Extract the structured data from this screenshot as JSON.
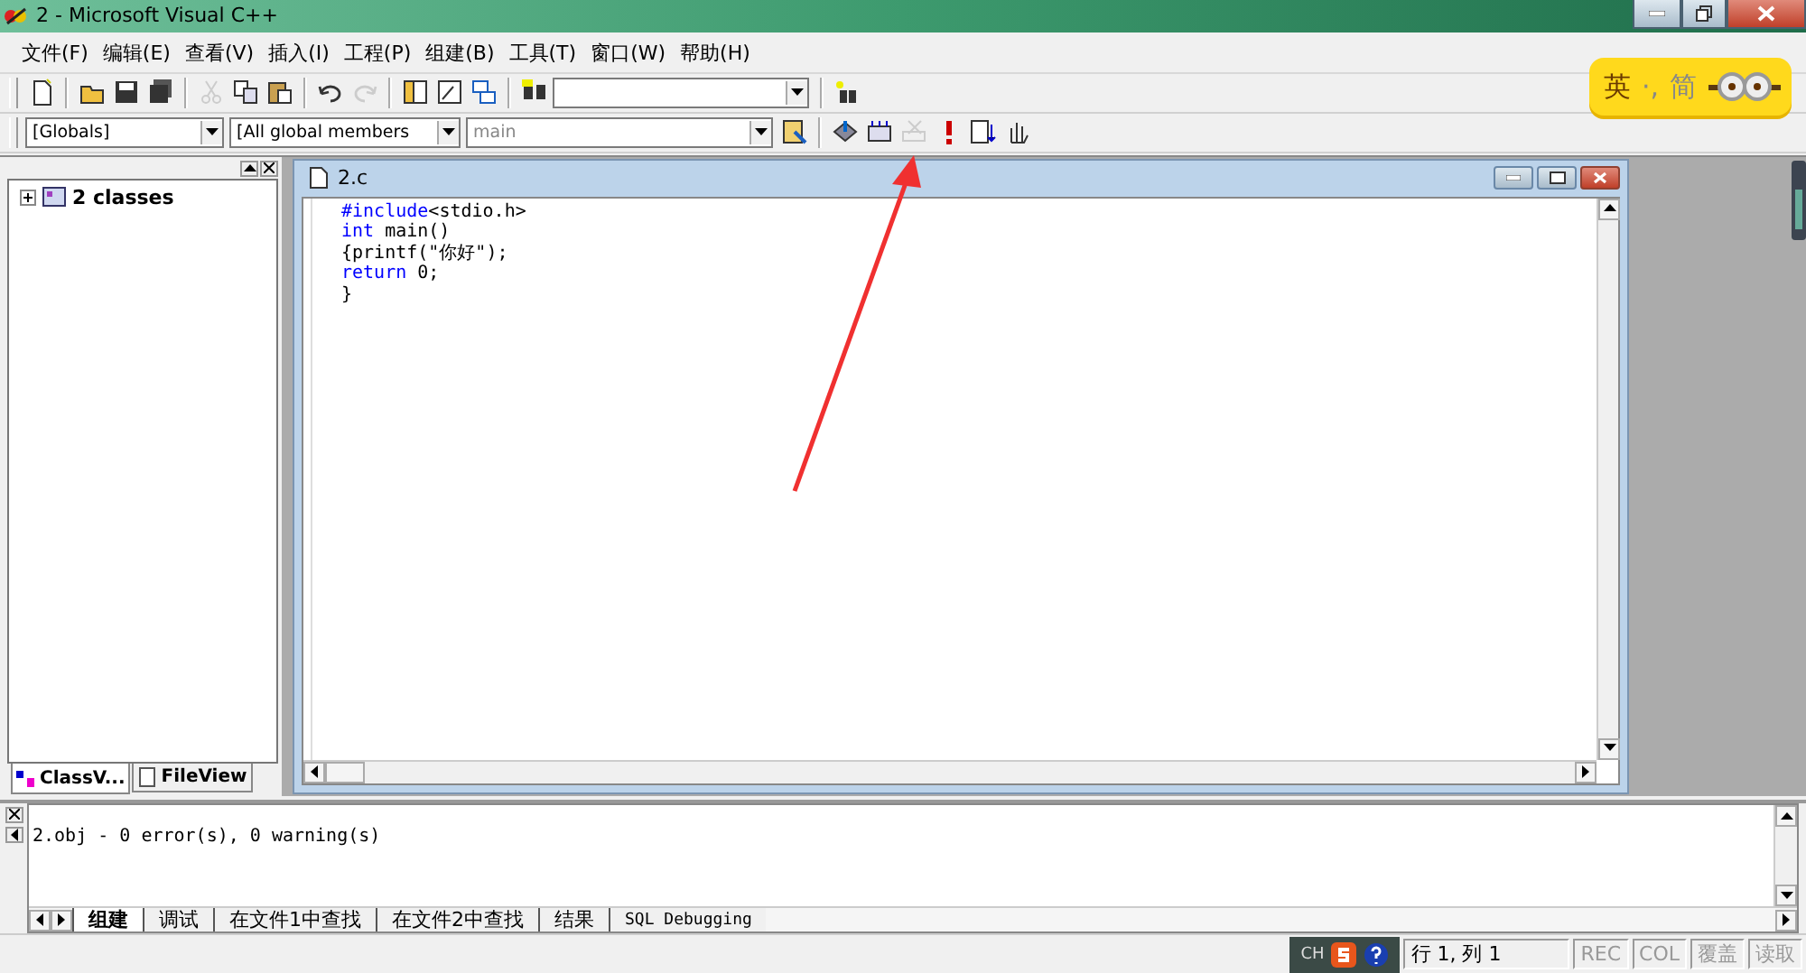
{
  "window": {
    "title": "2 - Microsoft Visual C++"
  },
  "menu": [
    "文件(F)",
    "编辑(E)",
    "查看(V)",
    "插入(I)",
    "工程(P)",
    "组建(B)",
    "工具(T)",
    "窗口(W)",
    "帮助(H)"
  ],
  "toolbar": [
    {
      "kind": "new",
      "disabled": false
    },
    {
      "kind": "sep"
    },
    {
      "kind": "open",
      "disabled": false
    },
    {
      "kind": "save",
      "disabled": false
    },
    {
      "kind": "saveall",
      "disabled": false
    },
    {
      "kind": "sep"
    },
    {
      "kind": "cut",
      "disabled": true
    },
    {
      "kind": "copy",
      "disabled": false
    },
    {
      "kind": "paste",
      "disabled": false
    },
    {
      "kind": "sep"
    },
    {
      "kind": "undo",
      "disabled": false
    },
    {
      "kind": "redo",
      "disabled": true
    },
    {
      "kind": "sep"
    },
    {
      "kind": "workspace",
      "disabled": false
    },
    {
      "kind": "output",
      "disabled": false
    },
    {
      "kind": "windows",
      "disabled": false
    },
    {
      "kind": "sep"
    },
    {
      "kind": "findfiles",
      "disabled": false
    },
    {
      "kind": "combo"
    },
    {
      "kind": "sep"
    },
    {
      "kind": "find",
      "disabled": false
    }
  ],
  "wizard_bar": {
    "combos": [
      {
        "value": "[Globals]",
        "disabled": false
      },
      {
        "value": "[All global members",
        "disabled": false
      },
      {
        "value": "main",
        "disabled": true
      }
    ],
    "buttons": [
      {
        "kind": "action",
        "disabled": false
      },
      {
        "kind": "sep"
      },
      {
        "kind": "compile",
        "disabled": false
      },
      {
        "kind": "build",
        "disabled": false
      },
      {
        "kind": "stop",
        "disabled": true
      },
      {
        "kind": "execute",
        "disabled": false
      },
      {
        "kind": "breakpointlist",
        "disabled": false
      },
      {
        "kind": "breakpoint",
        "disabled": false
      }
    ]
  },
  "ime_widget": {
    "mode": "英",
    "punct": "·,",
    "script": "简"
  },
  "workspace": {
    "tree": [
      {
        "label": "2 classes",
        "expanded": false
      }
    ],
    "tabs": [
      {
        "label": "ClassV...",
        "selected": true
      },
      {
        "label": "FileView",
        "selected": false
      }
    ]
  },
  "editor": {
    "title": "2.c",
    "lines": [
      [
        {
          "text": "#include",
          "kind": "keyword"
        },
        {
          "text": "<stdio.h>",
          "kind": "plain"
        }
      ],
      [
        {
          "text": "int",
          "kind": "keyword"
        },
        {
          "text": " main()",
          "kind": "plain"
        }
      ],
      [
        {
          "text": "{printf(\"你好\");",
          "kind": "plain"
        }
      ],
      [
        {
          "text": "return",
          "kind": "keyword"
        },
        {
          "text": " 0;",
          "kind": "plain"
        }
      ],
      [
        {
          "text": "}",
          "kind": "plain"
        }
      ]
    ]
  },
  "output": {
    "text": "2.obj - 0 error(s), 0 warning(s)",
    "tabs": [
      {
        "label": "组建",
        "selected": true
      },
      {
        "label": "调试",
        "selected": false
      },
      {
        "label": "在文件1中查找",
        "selected": false
      },
      {
        "label": "在文件2中查找",
        "selected": false
      },
      {
        "label": "结果",
        "selected": false
      },
      {
        "label": "SQL Debugging",
        "selected": false
      }
    ]
  },
  "status_bar": {
    "ime": "CH",
    "position": "行 1, 列 1",
    "indicators": [
      {
        "label": "REC",
        "disabled": true
      },
      {
        "label": "COL",
        "disabled": true
      },
      {
        "label": "覆盖",
        "disabled": true
      },
      {
        "label": "读取",
        "disabled": true
      }
    ]
  }
}
